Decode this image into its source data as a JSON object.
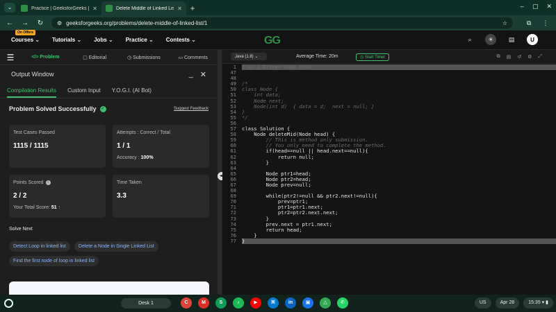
{
  "browser": {
    "tabs": [
      {
        "title": "Practice | GeeksforGeeks | A c"
      },
      {
        "title": "Delete Middle of Linked List | P"
      }
    ],
    "url": "geeksforgeeks.org/problems/delete-middle-of-linked-list/1"
  },
  "site": {
    "badge": "On Offers",
    "menu": [
      "Courses",
      "Tutorials",
      "Jobs",
      "Practice",
      "Contests"
    ],
    "logo": "GG",
    "user_initial": "U"
  },
  "left_panel": {
    "tabs": [
      "Problem",
      "Editorial",
      "Submissions",
      "Comments"
    ],
    "output_title": "Output Window",
    "result_tabs": [
      "Compilation Results",
      "Custom Input",
      "Y.O.G.I. (AI Bot)"
    ],
    "status": "Problem Solved Successfully",
    "feedback": "Suggest Feedback",
    "test_cases_label": "Test Cases Passed",
    "test_cases_value": "1115 / 1115",
    "attempts_label": "Attempts : Correct / Total",
    "attempts_value": "1 / 1",
    "accuracy_label": "Accuracy :",
    "accuracy_value": "100%",
    "points_label": "Points Scored",
    "points_value": "2 / 2",
    "total_score_label": "Your Total Score:",
    "total_score_value": "51",
    "time_label": "Time Taken",
    "time_value": "3.3",
    "solve_next_title": "Solve Next",
    "solve_next": [
      "Detect Loop in linked list",
      "Delete a Node in Single Linked List",
      "Find the first node of loop in linked list"
    ]
  },
  "editor": {
    "language": "Java (1.8)",
    "average_time": "Average Time: 20m",
    "timer_label": "Start Timer",
    "lines": [
      {
        "n": 1,
        "text": "} // } Driver Code Ends",
        "cls": "cm",
        "hl": true
      },
      {
        "n": 47,
        "text": "",
        "cls": "txt"
      },
      {
        "n": 48,
        "text": "",
        "cls": "txt"
      },
      {
        "n": 49,
        "text": "/*",
        "cls": "cm"
      },
      {
        "n": 50,
        "text": "class Node {",
        "cls": "cm"
      },
      {
        "n": 51,
        "text": "    int data;",
        "cls": "cm"
      },
      {
        "n": 52,
        "text": "    Node next;",
        "cls": "cm"
      },
      {
        "n": 53,
        "text": "    Node(int d)  { data = d;  next = null; }",
        "cls": "cm"
      },
      {
        "n": 54,
        "text": "}",
        "cls": "cm"
      },
      {
        "n": 55,
        "text": "*/",
        "cls": "cm"
      },
      {
        "n": 56,
        "text": "",
        "cls": "txt"
      },
      {
        "n": 57,
        "text": "class Solution {",
        "cls": "txt"
      },
      {
        "n": 58,
        "text": "    Node deleteMid(Node head) {",
        "cls": "txt"
      },
      {
        "n": 59,
        "text": "        // This is method only submission.",
        "cls": "cm"
      },
      {
        "n": 60,
        "text": "        // You only need to complete the method.",
        "cls": "cm"
      },
      {
        "n": 61,
        "text": "        if(head==null || head.next==null){",
        "cls": "txt"
      },
      {
        "n": 62,
        "text": "            return null;",
        "cls": "txt"
      },
      {
        "n": 63,
        "text": "        }",
        "cls": "txt"
      },
      {
        "n": 64,
        "text": "",
        "cls": "txt"
      },
      {
        "n": 65,
        "text": "        Node ptr1=head;",
        "cls": "txt"
      },
      {
        "n": 66,
        "text": "        Node ptr2=head;",
        "cls": "txt"
      },
      {
        "n": 67,
        "text": "        Node prev=null;",
        "cls": "txt"
      },
      {
        "n": 68,
        "text": "",
        "cls": "txt"
      },
      {
        "n": 69,
        "text": "        while(ptr2!=null && ptr2.next!=null){",
        "cls": "txt"
      },
      {
        "n": 70,
        "text": "            prev=ptr1;",
        "cls": "txt"
      },
      {
        "n": 71,
        "text": "            ptr1=ptr1.next;",
        "cls": "txt"
      },
      {
        "n": 72,
        "text": "            ptr2=ptr2.next.next;",
        "cls": "txt"
      },
      {
        "n": 73,
        "text": "        }",
        "cls": "txt"
      },
      {
        "n": 74,
        "text": "        prev.next = ptr1.next;",
        "cls": "txt"
      },
      {
        "n": 75,
        "text": "        return head;",
        "cls": "txt"
      },
      {
        "n": 76,
        "text": "    }",
        "cls": "txt"
      },
      {
        "n": 77,
        "text": "}",
        "cls": "txt",
        "hl": true
      }
    ]
  },
  "taskbar": {
    "desk": "Desk 1",
    "apps": [
      {
        "name": "chrome-icon",
        "label": "C",
        "color": "#db4437"
      },
      {
        "name": "gmail-icon",
        "label": "M",
        "color": "#d93025"
      },
      {
        "name": "sheets-icon",
        "label": "S",
        "color": "#0f9d58"
      },
      {
        "name": "spotify-icon",
        "label": "♪",
        "color": "#1db954"
      },
      {
        "name": "youtube-icon",
        "label": "▶",
        "color": "#ff0000"
      },
      {
        "name": "vscode-icon",
        "label": "⌘",
        "color": "#007acc"
      },
      {
        "name": "linkedin-icon",
        "label": "in",
        "color": "#0a66c2"
      },
      {
        "name": "files-icon",
        "label": "▣",
        "color": "#1a73e8"
      },
      {
        "name": "drive-icon",
        "label": "△",
        "color": "#34a853"
      },
      {
        "name": "whatsapp-icon",
        "label": "✆",
        "color": "#25d366"
      }
    ],
    "locale": "US",
    "date": "Apr 28",
    "time": "15:35"
  }
}
